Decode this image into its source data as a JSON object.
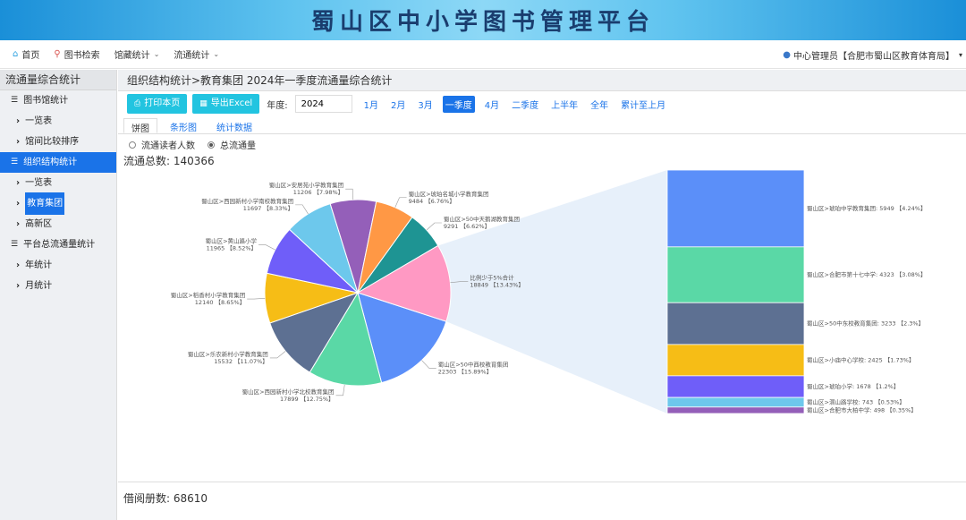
{
  "banner": {
    "title": "蜀山区中小学图书管理平台"
  },
  "nav": {
    "home": "首页",
    "search": "图书检索",
    "collection": "馆藏统计",
    "circulation": "流通统计",
    "user": "中心管理员【合肥市蜀山区教育体育局】"
  },
  "sidebar": {
    "header": "流通量综合统计",
    "items": [
      {
        "label": "图书馆统计",
        "level": 1
      },
      {
        "label": "一览表",
        "level": 2
      },
      {
        "label": "馆间比较排序",
        "level": 2
      },
      {
        "label": "组织结构统计",
        "level": 1
      },
      {
        "label": "一览表",
        "level": 2
      },
      {
        "label": "教育集团",
        "level": 2
      },
      {
        "label": "高新区",
        "level": 2
      },
      {
        "label": "平台总流通量统计",
        "level": 1
      },
      {
        "label": "年统计",
        "level": 2
      },
      {
        "label": "月统计",
        "level": 2
      }
    ]
  },
  "main": {
    "breadcrumb": "组织结构统计>教育集团    2024年一季度流通量综合统计",
    "print_btn": "打印本页",
    "export_btn": "导出Excel",
    "year_label": "年度:",
    "year_value": "2024",
    "periods": [
      "1月",
      "2月",
      "3月",
      "一季度",
      "4月",
      "二季度",
      "上半年",
      "全年",
      "累计至上月"
    ],
    "active_period": "一季度",
    "tabs": [
      "饼图",
      "条形图",
      "统计数据"
    ],
    "radio_readers": "流通读者人数",
    "radio_total": "总流通量",
    "total_label": "流通总数: 140366",
    "borrow_label": "借阅册数: 68610"
  },
  "chart_data": {
    "type": "pie",
    "title": "",
    "total": 140366,
    "slices": [
      {
        "name": "蜀山区>50中西校教育集团",
        "value": 22303,
        "pct": "15.89%",
        "color": "#5b8ff9"
      },
      {
        "name": "蜀山区>西园新村小学北校教育集团",
        "value": 17899,
        "pct": "12.75%",
        "color": "#5ad8a6"
      },
      {
        "name": "蜀山区>乐农新村小学教育集团",
        "value": 15532,
        "pct": "11.07%",
        "color": "#5d7092"
      },
      {
        "name": "蜀山区>稻香村小学教育集团",
        "value": 12140,
        "pct": "8.65%",
        "color": "#f6bd16"
      },
      {
        "name": "蜀山区>黄山路小学",
        "value": 11965,
        "pct": "8.52%",
        "color": "#6f5ef9"
      },
      {
        "name": "蜀山区>西园新村小学南校教育集团",
        "value": 11697,
        "pct": "8.33%",
        "color": "#6dc8ec"
      },
      {
        "name": "蜀山区>安居苑小学教育集团",
        "value": 11206,
        "pct": "7.98%",
        "color": "#945fb9"
      },
      {
        "name": "蜀山区>琥珀名城小学教育集团",
        "value": 9484,
        "pct": "6.76%",
        "color": "#ff9845"
      },
      {
        "name": "蜀山区>50中天鹅湖教育集团",
        "value": 9291,
        "pct": "6.62%",
        "color": "#1e9493"
      },
      {
        "name": "比例少于5%合计",
        "value": 18849,
        "pct": "13.43%",
        "color": "#ff99c3"
      }
    ],
    "breakdown": [
      {
        "name": "蜀山区>琥珀中学教育集团",
        "value": 5949,
        "pct": "4.24%",
        "color": "#5b8ff9"
      },
      {
        "name": "蜀山区>合肥市第十七中学",
        "value": 4323,
        "pct": "3.08%",
        "color": "#5ad8a6"
      },
      {
        "name": "蜀山区>50中东校教育集团",
        "value": 3233,
        "pct": "2.3%",
        "color": "#5d7092"
      },
      {
        "name": "蜀山区>小庙中心学校",
        "value": 2425,
        "pct": "1.73%",
        "color": "#f6bd16"
      },
      {
        "name": "蜀山区>琥珀小学",
        "value": 1678,
        "pct": "1.2%",
        "color": "#6f5ef9"
      },
      {
        "name": "蜀山区>潜山路学校",
        "value": 743,
        "pct": "0.53%",
        "color": "#6dc8ec"
      },
      {
        "name": "蜀山区>合肥市大柏中学",
        "value": 498,
        "pct": "0.35%",
        "color": "#945fb9"
      }
    ]
  }
}
